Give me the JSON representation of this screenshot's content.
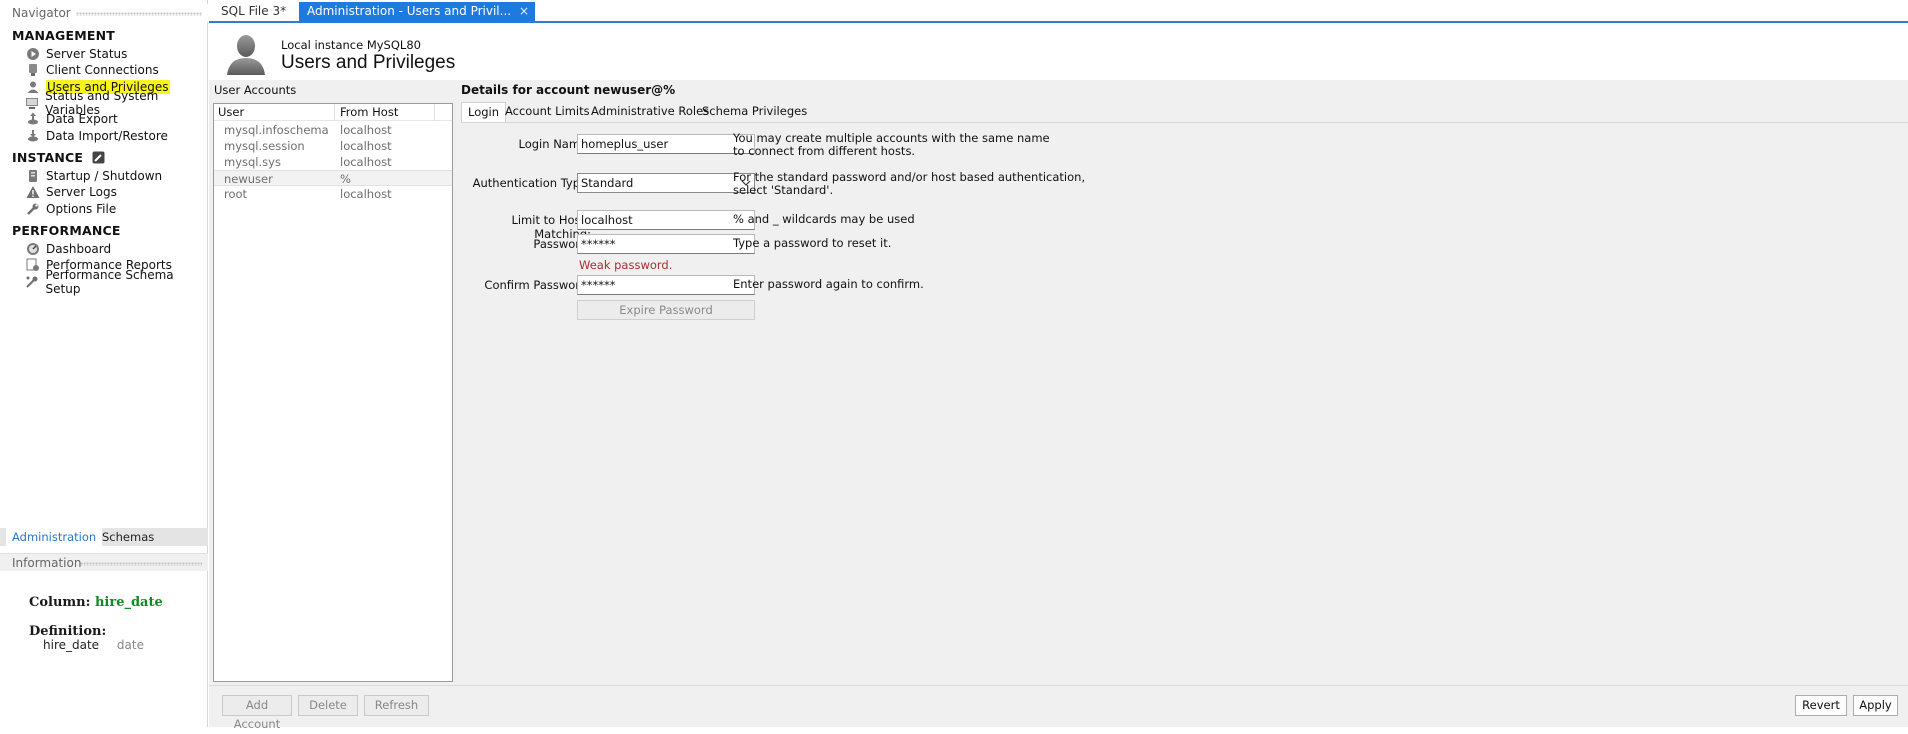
{
  "navigator": {
    "header": "Navigator",
    "sections": {
      "management": {
        "title": "MANAGEMENT",
        "items": [
          "Server Status",
          "Client Connections",
          "Users and Privileges",
          "Status and System Variables",
          "Data Export",
          "Data Import/Restore"
        ]
      },
      "instance": {
        "title": "INSTANCE",
        "items": [
          "Startup / Shutdown",
          "Server Logs",
          "Options File"
        ]
      },
      "performance": {
        "title": "PERFORMANCE",
        "items": [
          "Dashboard",
          "Performance Reports",
          "Performance Schema Setup"
        ]
      }
    },
    "tabs": [
      "Administration",
      "Schemas"
    ],
    "info": {
      "header": "Information",
      "column_label": "Column:",
      "column_value": "hire_date",
      "definition_label": "Definition:",
      "def_name": "hire_date",
      "def_type": "date"
    }
  },
  "doc_tabs": {
    "tab1": "SQL File 3*",
    "tab2": "Administration - Users and Privil...",
    "close": "×"
  },
  "header": {
    "subtitle": "Local instance MySQL80",
    "title": "Users and Privileges"
  },
  "accounts": {
    "label": "User Accounts",
    "columns": [
      "User",
      "From Host"
    ],
    "rows": [
      {
        "user": "mysql.infoschema",
        "host": "localhost"
      },
      {
        "user": "mysql.session",
        "host": "localhost"
      },
      {
        "user": "mysql.sys",
        "host": "localhost"
      },
      {
        "user": "newuser",
        "host": "%"
      },
      {
        "user": "root",
        "host": "localhost"
      }
    ]
  },
  "details": {
    "title": "Details for account newuser@%",
    "tabs": [
      "Login",
      "Account Limits",
      "Administrative Roles",
      "Schema Privileges"
    ],
    "login_name_label": "Login Name:",
    "login_name_value": "homeplus_user",
    "login_help_1": "You may create multiple accounts with the same name",
    "login_help_2": "to connect from different hosts.",
    "auth_label": "Authentication Type:",
    "auth_value": "Standard",
    "auth_help_1": "For the standard password and/or host based authentication,",
    "auth_help_2": "select 'Standard'.",
    "hosts_label": "Limit to Hosts Matching:",
    "hosts_value": "localhost",
    "hosts_help": "% and _ wildcards may be used",
    "password_label": "Password:",
    "password_value": "******",
    "password_help": "Type a password to reset it.",
    "weak_text": "Weak password.",
    "confirm_label": "Confirm Password:",
    "confirm_value": "******",
    "confirm_help": "Enter password again to confirm.",
    "expire_button": "Expire Password"
  },
  "bottom": {
    "add": "Add Account",
    "delete": "Delete",
    "refresh": "Refresh",
    "revert": "Revert",
    "apply": "Apply"
  },
  "colors": {
    "accent": "#1f7ae0",
    "highlight": "#f7f31d",
    "info_green": "#0f8b24",
    "weak_red": "#a5312e"
  }
}
